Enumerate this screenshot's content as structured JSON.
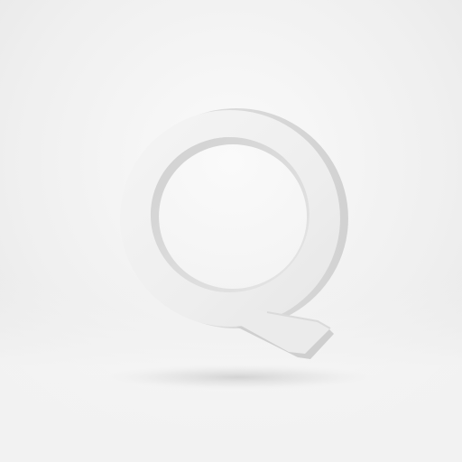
{
  "scene": {
    "subject": "Q",
    "colors": {
      "background_light": "#f7f7f7",
      "background_mid": "#ececec",
      "background_floor": "#f4f4f4",
      "letter_face": "#f0f0f0",
      "letter_side": "#d6d6d6",
      "letter_inner_shade": "#c9c9c9",
      "shadow": "#bdbdbd"
    }
  }
}
